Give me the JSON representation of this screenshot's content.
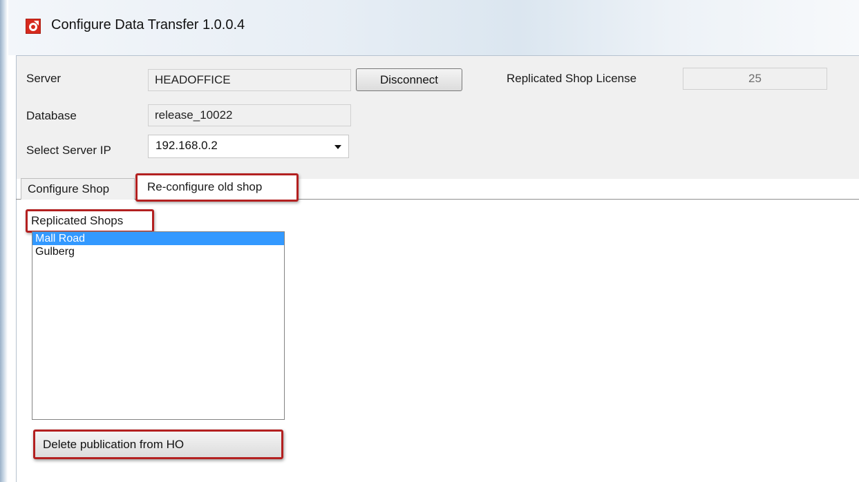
{
  "window": {
    "title": "Configure Data Transfer 1.0.0.4",
    "app_icon": "red-arrow-app-icon"
  },
  "form": {
    "server_label": "Server",
    "server_value": "HEADOFFICE",
    "disconnect_label": "Disconnect",
    "license_label": "Replicated Shop License",
    "license_value": "25",
    "database_label": "Database",
    "database_value": "release_10022",
    "server_ip_label": "Select Server IP",
    "server_ip_value": "192.168.0.2"
  },
  "tabs": [
    {
      "label": "Configure Shop",
      "active": false
    },
    {
      "label": "Re-configure old shop",
      "active": true
    }
  ],
  "shops": {
    "group_label": "Replicated Shops",
    "items": [
      {
        "label": "Mall Road",
        "selected": true
      },
      {
        "label": "Gulberg",
        "selected": false
      }
    ]
  },
  "actions": {
    "delete_label": "Delete publication from HO"
  },
  "colors": {
    "highlight_border": "#b32020",
    "selection": "#3399ff"
  }
}
